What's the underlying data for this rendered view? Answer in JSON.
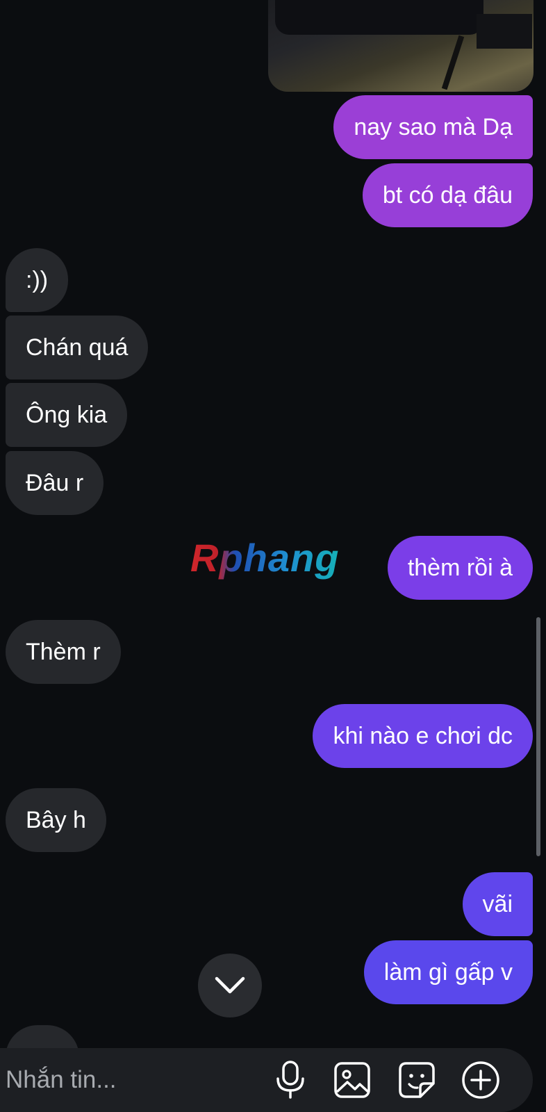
{
  "conversation": {
    "messages": [
      {
        "text": "nay sao mà Dạ",
        "direction": "outgoing",
        "color": "#9b3fd6"
      },
      {
        "text": "bt có dạ đâu",
        "direction": "outgoing",
        "color": "#973fd8"
      },
      {
        "text": ":))",
        "direction": "incoming"
      },
      {
        "text": "Chán quá",
        "direction": "incoming"
      },
      {
        "text": "Ông kia",
        "direction": "incoming"
      },
      {
        "text": "Đâu r",
        "direction": "incoming"
      },
      {
        "text": "thèm rồi à",
        "direction": "outgoing",
        "color": "#7b3ee8"
      },
      {
        "text": "Thèm r",
        "direction": "incoming"
      },
      {
        "text": "khi nào e chơi dc",
        "direction": "outgoing",
        "color": "#6c42ea"
      },
      {
        "text": "Bây h",
        "direction": "incoming"
      },
      {
        "text": "vãi",
        "direction": "outgoing",
        "color": "#6046ec"
      },
      {
        "text": "làm gì gấp v",
        "direction": "outgoing",
        "color": "#5a48ec"
      },
      {
        "text": "...",
        "direction": "incoming"
      }
    ]
  },
  "watermark": "Rphang",
  "composer": {
    "placeholder": "Nhắn tin...",
    "icons": [
      "microphone-icon",
      "image-icon",
      "sticker-icon",
      "plus-circle-icon"
    ]
  },
  "colors": {
    "background": "#0b0d10",
    "incoming_bubble": "#26282c",
    "composer_bg": "#1d1f23"
  }
}
